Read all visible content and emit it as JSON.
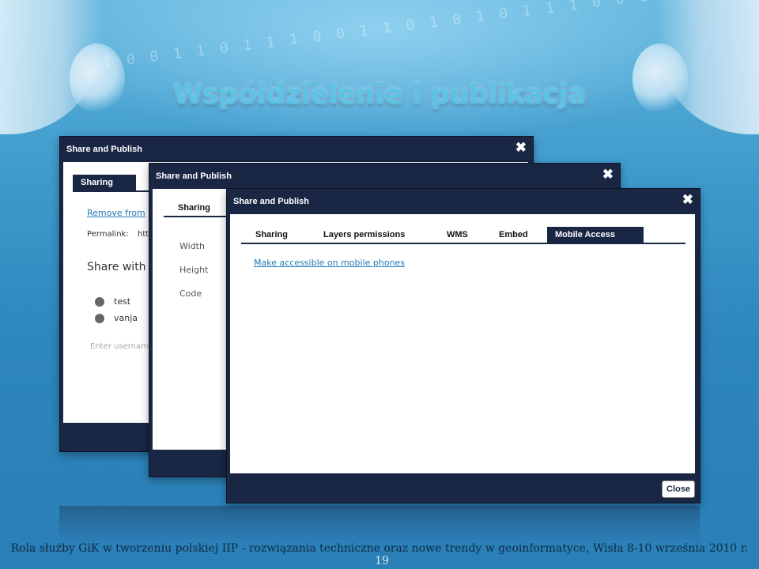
{
  "slide": {
    "title": "Współdzielenie i publikacja",
    "binary_text": "1 0 0 1 1 0 1 1 1 0 0 1 1 0 1 0 1 0 1 1 1 0 0 1 0 1 0 1",
    "footer": "Rola służby GiK w tworzeniu polskiej IIP - rozwiązania techniczne oraz nowe trendy w geoinformatyce, Wisła 8-10 września 2010 r.",
    "page_number": "19"
  },
  "win1": {
    "title": "Share and Publish",
    "close_glyph": "✖",
    "tab": "Sharing",
    "remove_link": "Remove from",
    "permalink_label": "Permalink:",
    "permalink_value": "http",
    "share_with": "Share with",
    "users": [
      "test",
      "vanja"
    ],
    "username_placeholder": "Enter username"
  },
  "win2": {
    "title": "Share and Publish",
    "close_glyph": "✖",
    "tab": "Sharing",
    "fields": [
      "Width",
      "Height",
      "Code"
    ]
  },
  "win3": {
    "title": "Share and Publish",
    "close_glyph": "✖",
    "tabs": [
      "Sharing",
      "Layers permissions",
      "WMS",
      "Embed",
      "Mobile Access"
    ],
    "mobile_link": "Make accessible on mobile phones",
    "close_button": "Close"
  }
}
